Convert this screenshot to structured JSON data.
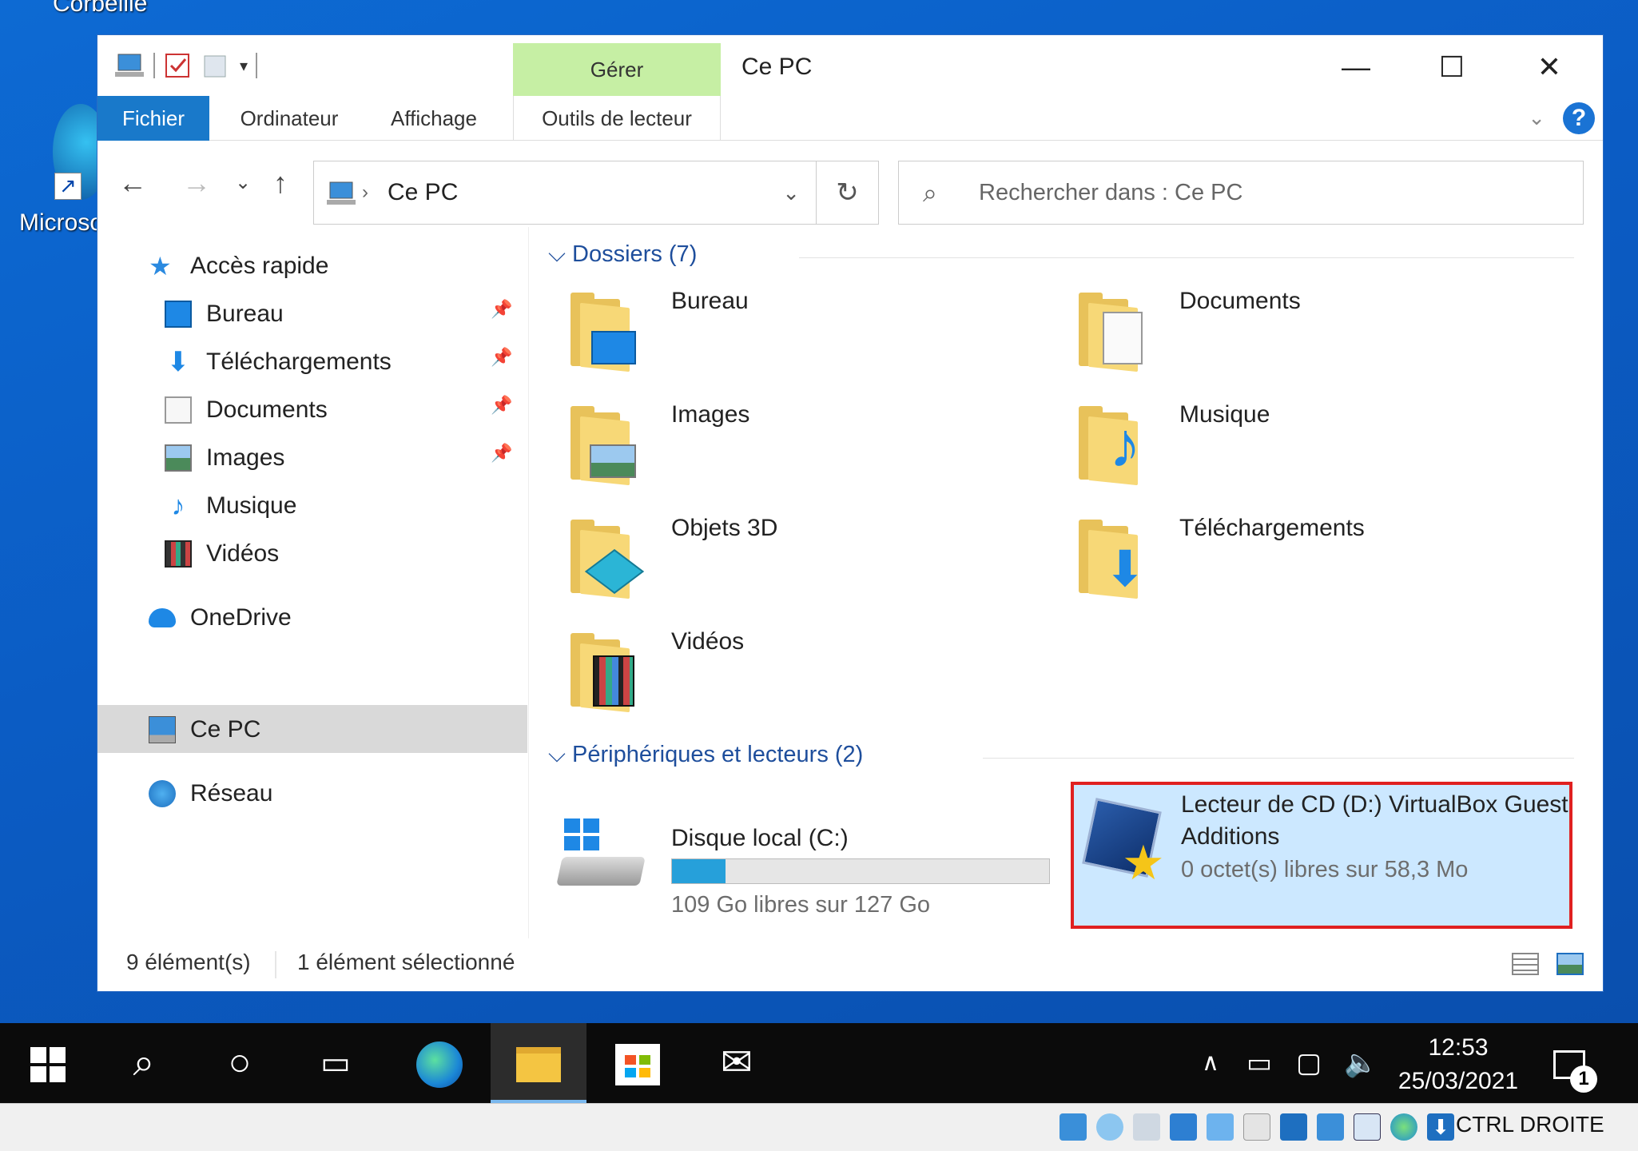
{
  "desktop": {
    "icons": [
      {
        "label": "Corbeille"
      },
      {
        "label": "Microso"
      }
    ]
  },
  "window": {
    "title": "Ce PC",
    "contextual_group": "Gérer",
    "controls": {
      "minimize": "—",
      "maximize": "☐",
      "close": "✕"
    },
    "ribbon_tabs": [
      "Fichier",
      "Ordinateur",
      "Affichage",
      "Outils de lecteur"
    ],
    "help": "?"
  },
  "navbar": {
    "address": "Ce PC",
    "search_placeholder": "Rechercher dans : Ce PC"
  },
  "nav_pane": {
    "quick_access": "Accès rapide",
    "items": [
      {
        "label": "Bureau",
        "pinned": true,
        "icon": "desktop-icon"
      },
      {
        "label": "Téléchargements",
        "pinned": true,
        "icon": "download-arrow-icon"
      },
      {
        "label": "Documents",
        "pinned": true,
        "icon": "document-icon"
      },
      {
        "label": "Images",
        "pinned": true,
        "icon": "picture-icon"
      },
      {
        "label": "Musique",
        "pinned": false,
        "icon": "music-note-icon"
      },
      {
        "label": "Vidéos",
        "pinned": false,
        "icon": "film-icon"
      }
    ],
    "onedrive": "OneDrive",
    "this_pc": "Ce PC",
    "network": "Réseau"
  },
  "content": {
    "folders_header": "Dossiers (7)",
    "folders": [
      {
        "name": "Bureau",
        "overlay": "desktop"
      },
      {
        "name": "Documents",
        "overlay": "document"
      },
      {
        "name": "Images",
        "overlay": "landscape"
      },
      {
        "name": "Musique",
        "overlay": "music-note"
      },
      {
        "name": "Objets 3D",
        "overlay": "cube"
      },
      {
        "name": "Téléchargements",
        "overlay": "down-arrow"
      },
      {
        "name": "Vidéos",
        "overlay": "film"
      }
    ],
    "devices_header": "Périphériques et lecteurs (2)",
    "drives": [
      {
        "name": "Disque local (C:)",
        "free": "109 Go libres sur 127 Go",
        "used_fraction": 0.142
      },
      {
        "name_line1": "Lecteur de CD (D:) VirtualBox Guest",
        "name_line2": "Additions",
        "free": "0 octet(s) libres sur 58,3 Mo",
        "selected": true
      }
    ]
  },
  "status": {
    "count": "9 élément(s)",
    "selection": "1 élément sélectionné"
  },
  "taskbar": {
    "time": "12:53",
    "date": "25/03/2021",
    "notifications": "1"
  },
  "vbox_status": {
    "host_key": "CTRL DROITE"
  },
  "colors": {
    "accent": "#1979ca",
    "selection_bg": "#cce8ff",
    "highlight_border": "#e02020",
    "context_tab": "#c6efa4"
  }
}
